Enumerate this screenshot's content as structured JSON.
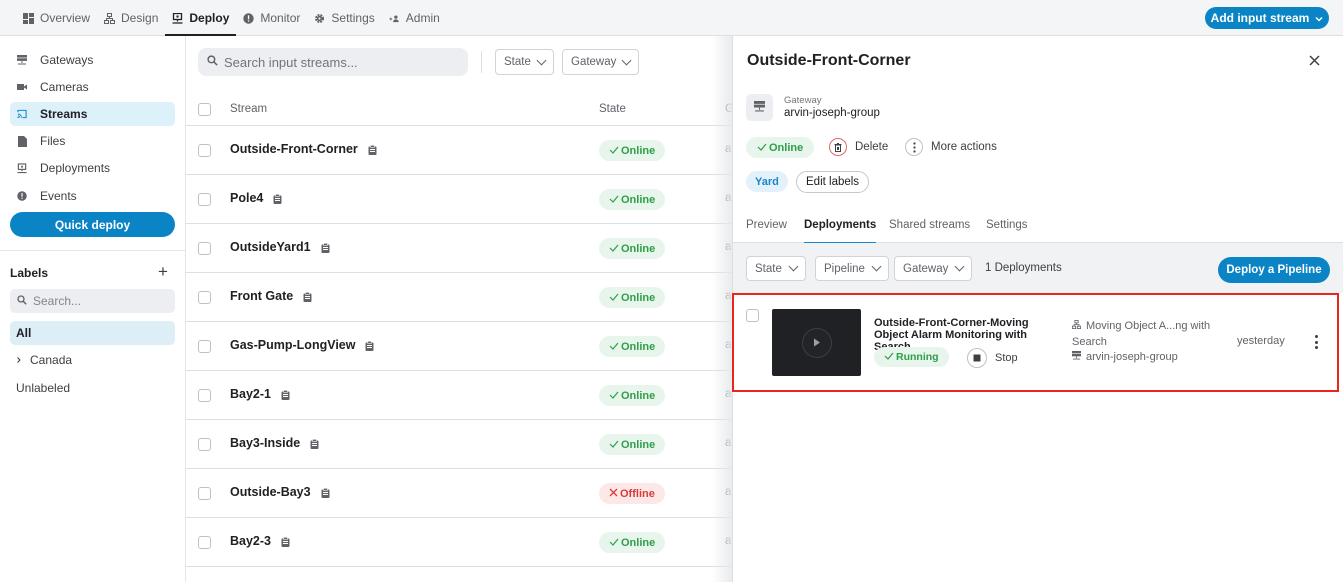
{
  "topnav": {
    "items": [
      {
        "label": "Overview",
        "icon": "dashboard-grid-icon",
        "active": false
      },
      {
        "label": "Design",
        "icon": "hierarchy-icon",
        "active": false
      },
      {
        "label": "Deploy",
        "icon": "monitor-stand-icon",
        "active": true
      },
      {
        "label": "Monitor",
        "icon": "alert-circle-icon",
        "active": false
      },
      {
        "label": "Settings",
        "icon": "gear-icon",
        "active": false
      },
      {
        "label": "Admin",
        "icon": "admin-user-icon",
        "active": false
      }
    ],
    "add_stream_label": "Add input stream"
  },
  "sidebar": {
    "items": [
      {
        "label": "Gateways",
        "icon": "server-icon",
        "active": false
      },
      {
        "label": "Cameras",
        "icon": "camera-icon",
        "active": false
      },
      {
        "label": "Streams",
        "icon": "cast-icon",
        "active": true
      },
      {
        "label": "Files",
        "icon": "file-icon",
        "active": false
      },
      {
        "label": "Deployments",
        "icon": "monitor-stand-icon",
        "active": false
      },
      {
        "label": "Events",
        "icon": "alert-circle-icon",
        "active": false
      }
    ],
    "quick_deploy_label": "Quick deploy",
    "labels_title": "Labels",
    "labels_add": "+",
    "labels_search_placeholder": "Search...",
    "label_items": [
      {
        "label": "All",
        "active": true,
        "expandable": false
      },
      {
        "label": "Canada",
        "active": false,
        "expandable": true
      },
      {
        "label": "Unlabeled",
        "active": false,
        "expandable": false
      }
    ]
  },
  "streams": {
    "search_placeholder": "Search input streams...",
    "filters": [
      "State",
      "Gateway"
    ],
    "columns": [
      "Stream",
      "State",
      "G"
    ],
    "rows": [
      {
        "name": "Outside-Front-Corner",
        "state": "Online",
        "gateway": "a"
      },
      {
        "name": "Pole4",
        "state": "Online",
        "gateway": "a"
      },
      {
        "name": "OutsideYard1",
        "state": "Online",
        "gateway": "a"
      },
      {
        "name": "Front Gate",
        "state": "Online",
        "gateway": "a"
      },
      {
        "name": "Gas-Pump-LongView",
        "state": "Online",
        "gateway": "a"
      },
      {
        "name": "Bay2-1",
        "state": "Online",
        "gateway": "a"
      },
      {
        "name": "Bay3-Inside",
        "state": "Online",
        "gateway": "a"
      },
      {
        "name": "Outside-Bay3",
        "state": "Offline",
        "gateway": "a"
      },
      {
        "name": "Bay2-3",
        "state": "Online",
        "gateway": "a"
      }
    ]
  },
  "panel": {
    "title": "Outside-Front-Corner",
    "gateway_label": "Gateway",
    "gateway_name": "arvin-joseph-group",
    "state": "Online",
    "delete_label": "Delete",
    "more_actions_label": "More actions",
    "labels": [
      "Yard"
    ],
    "edit_labels": "Edit labels",
    "tabs": [
      {
        "label": "Preview",
        "active": false
      },
      {
        "label": "Deployments",
        "active": true
      },
      {
        "label": "Shared streams",
        "active": false
      },
      {
        "label": "Settings",
        "active": false
      }
    ],
    "dep_filters": [
      "State",
      "Pipeline",
      "Gateway"
    ],
    "dep_count": "1 Deployments",
    "deploy_button": "Deploy a Pipeline",
    "deployments": [
      {
        "title": "Outside-Front-Corner-Moving Object Alarm Monitoring with Search",
        "status": "Running",
        "stop_label": "Stop",
        "pipeline": "Moving Object A...ng with Search",
        "gateway": "arvin-joseph-group",
        "when": "yesterday"
      }
    ]
  },
  "colors": {
    "accent": "#0b84c6",
    "online": "#2e9e48",
    "offline": "#d93a3a",
    "highlight": "#e8261c"
  }
}
